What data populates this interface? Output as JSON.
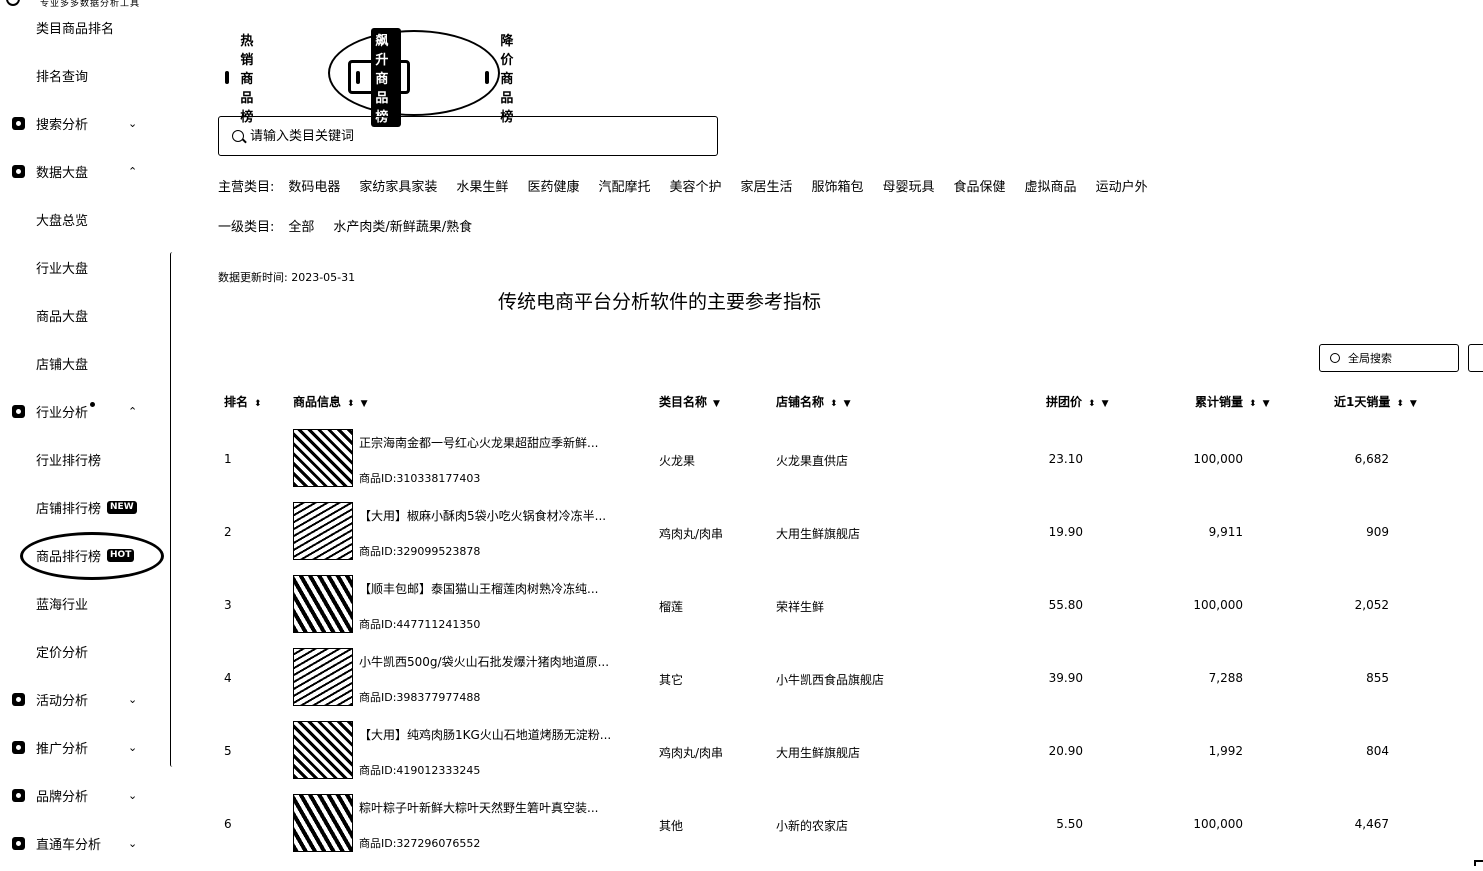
{
  "app": {
    "tagline": "专业多多数据分析工具"
  },
  "sidebar": {
    "items": [
      {
        "label": "类目商品排名",
        "kind": "sub"
      },
      {
        "label": "排名查询",
        "kind": "sub"
      },
      {
        "label": "搜索分析",
        "kind": "top",
        "icon": "search-analysis-icon",
        "expanded": false
      },
      {
        "label": "数据大盘",
        "kind": "top",
        "icon": "data-dashboard-icon",
        "expanded": true
      },
      {
        "label": "大盘总览",
        "kind": "sub"
      },
      {
        "label": "行业大盘",
        "kind": "sub"
      },
      {
        "label": "商品大盘",
        "kind": "sub"
      },
      {
        "label": "店铺大盘",
        "kind": "sub"
      },
      {
        "label": "行业分析",
        "kind": "top",
        "icon": "industry-analysis-icon",
        "expanded": true,
        "dot": true
      },
      {
        "label": "行业排行榜",
        "kind": "sub"
      },
      {
        "label": "店铺排行榜",
        "kind": "sub",
        "badge": "NEW"
      },
      {
        "label": "商品排行榜",
        "kind": "sub",
        "badge": "HOT",
        "selected": true
      },
      {
        "label": "蓝海行业",
        "kind": "sub"
      },
      {
        "label": "定价分析",
        "kind": "sub"
      },
      {
        "label": "活动分析",
        "kind": "top",
        "icon": "activity-analysis-icon",
        "expanded": false
      },
      {
        "label": "推广分析",
        "kind": "top",
        "icon": "promotion-analysis-icon",
        "expanded": false
      },
      {
        "label": "品牌分析",
        "kind": "top",
        "icon": "brand-analysis-icon",
        "expanded": false
      },
      {
        "label": "直通车分析",
        "kind": "top",
        "icon": "ad-analysis-icon",
        "expanded": false
      }
    ]
  },
  "tabs": [
    {
      "label": "热销商品榜",
      "icon": "fire-icon",
      "active": false
    },
    {
      "label": "飙升商品榜",
      "icon": "arrow-up-icon",
      "active": true
    },
    {
      "label": "降价商品榜",
      "icon": "price-down-icon",
      "active": false
    }
  ],
  "search": {
    "placeholder": "请输入类目关键词"
  },
  "main_categories": {
    "lead": "主营类目:",
    "options": [
      "数码电器",
      "家纺家具家装",
      "水果生鲜",
      "医药健康",
      "汽配摩托",
      "美容个护",
      "家居生活",
      "服饰箱包",
      "母婴玩具",
      "食品保健",
      "虚拟商品",
      "运动户外"
    ]
  },
  "level1_categories": {
    "lead": "一级类目:",
    "options": [
      "全部",
      "水产肉类/新鲜蔬果/熟食"
    ]
  },
  "update_time": "数据更新时间: 2023-05-31",
  "heading": "传统电商平台分析软件的主要参考指标",
  "global_search": {
    "placeholder": "全局搜索"
  },
  "table": {
    "columns": [
      "排名",
      "商品信息",
      "类目名称",
      "店铺名称",
      "拼团价",
      "累计销量",
      "近1天销量"
    ],
    "rows": [
      {
        "rank": "1",
        "title": "正宗海南金都一号红心火龙果超甜应季新鲜...",
        "id": "商品ID:310338177403",
        "category": "火龙果",
        "shop": "火龙果直供店",
        "price": "23.10",
        "total_sales": "100,000",
        "day_sales": "6,682"
      },
      {
        "rank": "2",
        "title": "【大用】椒麻小酥肉5袋小吃火锅食材冷冻半...",
        "id": "商品ID:329099523878",
        "category": "鸡肉丸/肉串",
        "shop": "大用生鲜旗舰店",
        "price": "19.90",
        "total_sales": "9,911",
        "day_sales": "909"
      },
      {
        "rank": "3",
        "title": "【顺丰包邮】泰国猫山王榴莲肉树熟冷冻纯...",
        "id": "商品ID:447711241350",
        "category": "榴莲",
        "shop": "荣祥生鲜",
        "price": "55.80",
        "total_sales": "100,000",
        "day_sales": "2,052"
      },
      {
        "rank": "4",
        "title": "小牛凯西500g/袋火山石批发爆汁猪肉地道原...",
        "id": "商品ID:398377977488",
        "category": "其它",
        "shop": "小牛凯西食品旗舰店",
        "price": "39.90",
        "total_sales": "7,288",
        "day_sales": "855"
      },
      {
        "rank": "5",
        "title": "【大用】纯鸡肉肠1KG火山石地道烤肠无淀粉...",
        "id": "商品ID:419012333245",
        "category": "鸡肉丸/肉串",
        "shop": "大用生鲜旗舰店",
        "price": "20.90",
        "total_sales": "1,992",
        "day_sales": "804"
      },
      {
        "rank": "6",
        "title": "粽叶粽子叶新鲜大粽叶天然野生箬叶真空装...",
        "id": "商品ID:327296076552",
        "category": "其他",
        "shop": "小新的农家店",
        "price": "5.50",
        "total_sales": "100,000",
        "day_sales": "4,467"
      }
    ]
  }
}
